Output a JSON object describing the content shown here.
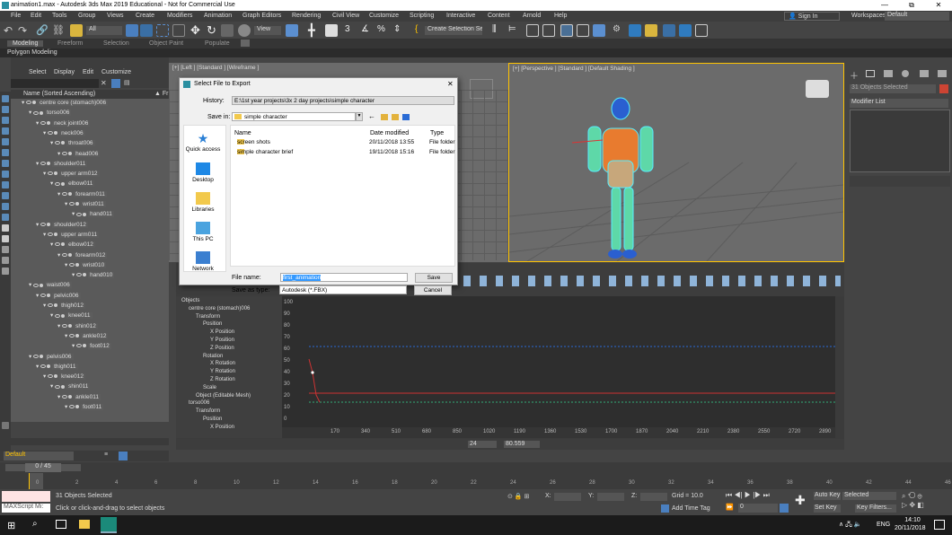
{
  "window": {
    "title": "animation1.max - Autodesk 3ds Max 2019 Educational - Not for Commercial Use",
    "minimize": "—",
    "maximize": "⧉",
    "close": "✕"
  },
  "menus": [
    "File",
    "Edit",
    "Tools",
    "Group",
    "Views",
    "Create",
    "Modifiers",
    "Animation",
    "Graph Editors",
    "Rendering",
    "Civil View",
    "Customize",
    "Scripting",
    "Interactive",
    "Content",
    "Arnold",
    "Help"
  ],
  "signin": "Sign In",
  "workspaces_label": "Workspaces:",
  "workspaces_value": "Default",
  "toolbar": {
    "filter": "All",
    "view": "View",
    "selection_set": "Create Selection Se"
  },
  "ribbon": {
    "tabs": [
      "Modeling",
      "Freeform",
      "Selection",
      "Object Paint",
      "Populate"
    ],
    "sub": "Polygon Modeling"
  },
  "scene_explorer": {
    "menus": [
      "Select",
      "Display",
      "Edit",
      "Customize"
    ],
    "header": "Name (Sorted Ascending)",
    "header2": "▲ Fr",
    "rows": [
      {
        "label": "centre core (stomach)006",
        "indent": 0,
        "sel": true
      },
      {
        "label": "torso006",
        "indent": 1,
        "sel": true
      },
      {
        "label": "neck joint006",
        "indent": 2,
        "sel": true
      },
      {
        "label": "neck006",
        "indent": 3,
        "sel": true
      },
      {
        "label": "throat006",
        "indent": 4,
        "sel": true
      },
      {
        "label": "head006",
        "indent": 5,
        "sel": true
      },
      {
        "label": "shoulder011",
        "indent": 2,
        "sel": true
      },
      {
        "label": "upper arm012",
        "indent": 3,
        "sel": true
      },
      {
        "label": "elbow011",
        "indent": 4,
        "sel": true
      },
      {
        "label": "forearm011",
        "indent": 5,
        "sel": true
      },
      {
        "label": "wrist011",
        "indent": 6,
        "sel": true
      },
      {
        "label": "hand011",
        "indent": 7,
        "sel": true
      },
      {
        "label": "shoulder012",
        "indent": 2,
        "sel": true
      },
      {
        "label": "upper arm011",
        "indent": 3,
        "sel": true
      },
      {
        "label": "elbow012",
        "indent": 4,
        "sel": true
      },
      {
        "label": "forearm012",
        "indent": 5,
        "sel": true
      },
      {
        "label": "wrist010",
        "indent": 6,
        "sel": true
      },
      {
        "label": "hand010",
        "indent": 7,
        "sel": true
      },
      {
        "label": "waist006",
        "indent": 1,
        "sel": true
      },
      {
        "label": "pelvic006",
        "indent": 2,
        "sel": true
      },
      {
        "label": "thigh012",
        "indent": 3,
        "sel": true
      },
      {
        "label": "knee011",
        "indent": 4,
        "sel": true
      },
      {
        "label": "shin012",
        "indent": 5,
        "sel": true
      },
      {
        "label": "ankle012",
        "indent": 6,
        "sel": true
      },
      {
        "label": "foot012",
        "indent": 7,
        "sel": true
      },
      {
        "label": "pelvis006",
        "indent": 1,
        "sel": true
      },
      {
        "label": "thigh011",
        "indent": 2,
        "sel": true
      },
      {
        "label": "knee012",
        "indent": 3,
        "sel": true
      },
      {
        "label": "shin011",
        "indent": 4,
        "sel": true
      },
      {
        "label": "ankle011",
        "indent": 5,
        "sel": true
      },
      {
        "label": "foot011",
        "indent": 6,
        "sel": true
      }
    ]
  },
  "viewports": {
    "left": "[+] [Left ] [Standard ] [Wireframe ]",
    "persp": "[+] [Perspective ] [Standard ] [Default Shading ]"
  },
  "cmdpanel": {
    "selected": "31 Objects Selected",
    "modlist": "Modifier List"
  },
  "dialog": {
    "title": "Select File to Export",
    "history_label": "History:",
    "history_value": "E:\\1st year projects\\3x 2 day projects\\simple character",
    "savein_label": "Save in:",
    "savein_value": "simple character",
    "places": [
      "Quick access",
      "Desktop",
      "Libraries",
      "This PC",
      "Network"
    ],
    "columns": [
      "Name",
      "Date modified",
      "Type"
    ],
    "files": [
      {
        "name": "screen shots",
        "date": "20/11/2018 13:55",
        "type": "File folder"
      },
      {
        "name": "simple character brief",
        "date": "19/11/2018 15:16",
        "type": "File folder"
      }
    ],
    "filename_label": "File name:",
    "filename_value": "first_animation",
    "savetype_label": "Save as type:",
    "savetype_value": "Autodesk (*.FBX)",
    "save": "Save",
    "cancel": "Cancel"
  },
  "trackview": {
    "tree": [
      "Objects",
      "centre core (stomach)006",
      "Transform",
      "Position",
      "X Position",
      "Y Position",
      "Z Position",
      "Rotation",
      "X Rotation",
      "Y Rotation",
      "Z Rotation",
      "Scale",
      "Object (Editable Mesh)",
      "torso006",
      "Transform",
      "Position",
      "X Position"
    ],
    "yticks": [
      "100",
      "90",
      "80",
      "70",
      "60",
      "50",
      "40",
      "30",
      "20",
      "10",
      "0"
    ],
    "xticks": [
      "170",
      "340",
      "510",
      "680",
      "850",
      "1020",
      "1190",
      "1360",
      "1530",
      "1700",
      "1870",
      "2040",
      "2210",
      "2380",
      "2550",
      "2720",
      "2890"
    ],
    "frame": "24",
    "value": "80.559"
  },
  "timeline": {
    "default": "Default",
    "slider": "0 / 45",
    "ticks": [
      "0",
      "2",
      "4",
      "6",
      "8",
      "10",
      "12",
      "14",
      "16",
      "18",
      "20",
      "22",
      "24",
      "26",
      "28",
      "30",
      "32",
      "34",
      "36",
      "38",
      "40",
      "42",
      "44",
      "46"
    ]
  },
  "status": {
    "objects": "31 Objects Selected",
    "hint": "Click or click-and-drag to select objects",
    "maxscript": "MAXScript Mi:",
    "x": "X:",
    "y": "Y:",
    "z": "Z:",
    "grid": "Grid = 10.0",
    "addtime": "Add Time Tag",
    "autokey": "Auto Key",
    "selected": "Selected",
    "setkey": "Set Key",
    "keyfilters": "Key Filters...",
    "frame": "0"
  },
  "taskbar": {
    "lang": "ENG",
    "time": "14:10",
    "date": "20/11/2018"
  }
}
